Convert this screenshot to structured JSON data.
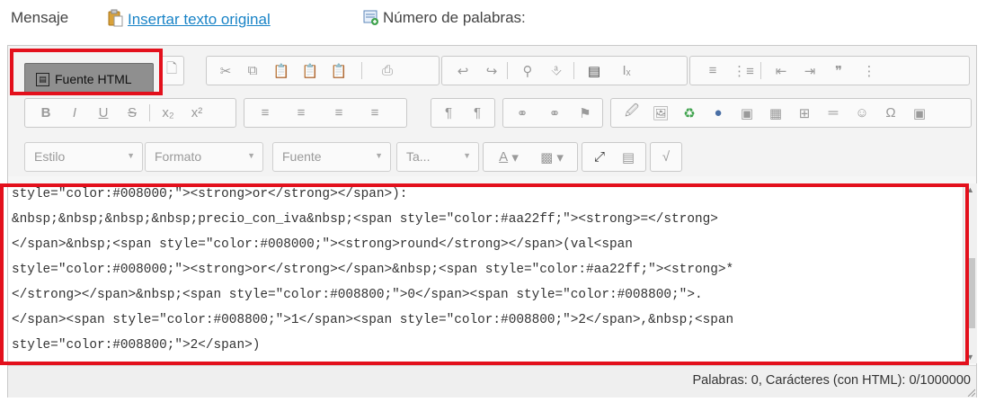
{
  "header": {
    "mensaje_label": "Mensaje",
    "insert_link": "Insertar texto original",
    "word_count_label": "Número de palabras:"
  },
  "toolbar": {
    "source_button": "Fuente HTML",
    "combos": {
      "style": "Estilo",
      "format": "Formato",
      "font": "Fuente",
      "size": "Ta..."
    }
  },
  "source_lines": [
    "style=\"color:#008000;\"><strong>or</strong></span>):",
    "&nbsp;&nbsp;&nbsp;&nbsp;precio_con_iva&nbsp;<span style=\"color:#aa22ff;\"><strong>=</strong>",
    "</span>&nbsp;<span style=\"color:#008000;\"><strong>round</strong></span>(val<span",
    "style=\"color:#008000;\"><strong>or</strong></span>&nbsp;<span style=\"color:#aa22ff;\"><strong>*",
    "</strong></span>&nbsp;<span style=\"color:#008800;\">0</span><span style=\"color:#008800;\">.",
    "</span><span style=\"color:#008800;\">1</span><span style=\"color:#008800;\">2</span>,&nbsp;<span",
    "style=\"color:#008800;\">2</span>)"
  ],
  "status": {
    "text": "Palabras: 0, Carácteres (con HTML): 0/1000000"
  },
  "colors": {
    "highlight": "#e3101c",
    "link": "#1a84c7"
  }
}
